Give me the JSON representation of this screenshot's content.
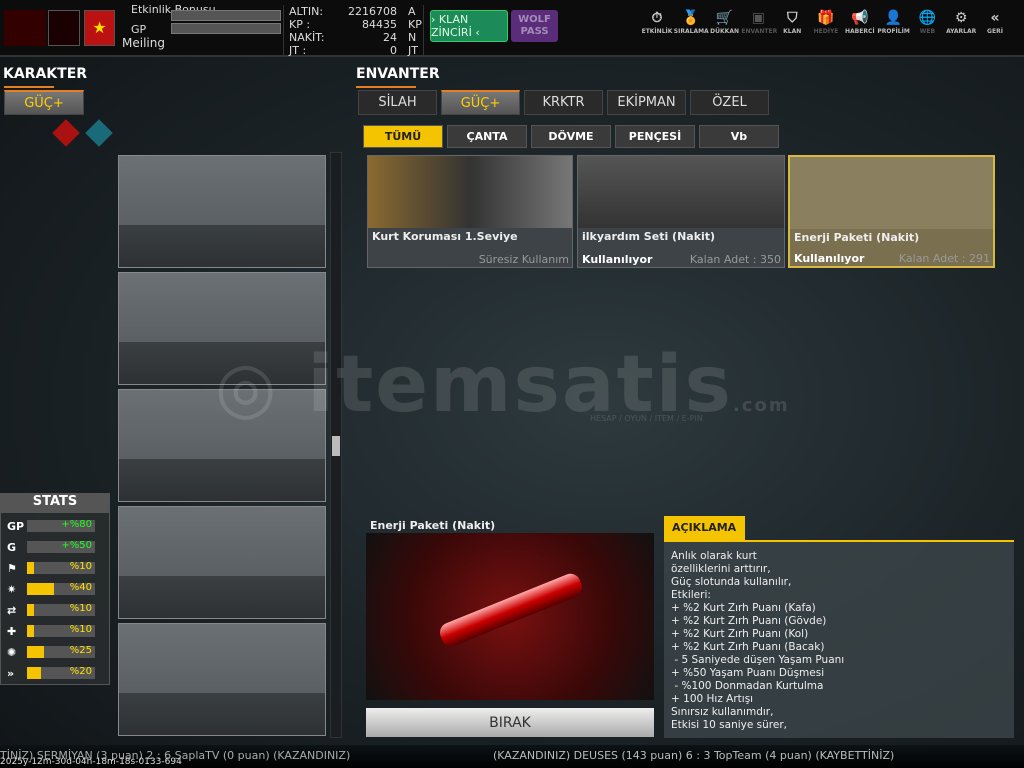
{
  "header": {
    "event_bonus_label": "Etkinlik Bonusu",
    "gp_label": "GP",
    "player_name": "Meiling",
    "currencies": [
      {
        "label": "ALTIN:",
        "value": "2216708",
        "unit": "A"
      },
      {
        "label": "KP :",
        "value": "84435",
        "unit": "KP"
      },
      {
        "label": "NAKİT:",
        "value": "24",
        "unit": "N"
      },
      {
        "label": "JT :",
        "value": "0",
        "unit": "JT"
      }
    ],
    "klan_button": "› KLAN ZİNCİRİ ‹",
    "wolf_pass": "WOLF PASS",
    "nav": [
      {
        "label": "ETKİNLİK",
        "icon": "⏱"
      },
      {
        "label": "SIRALAMA",
        "icon": "🏅"
      },
      {
        "label": "DÜKKAN",
        "icon": "🛒"
      },
      {
        "label": "ENVANTER",
        "icon": "▣"
      },
      {
        "label": "KLAN",
        "icon": "⛉"
      },
      {
        "label": "HEDİYE",
        "icon": "🎁"
      },
      {
        "label": "HABERCİ",
        "icon": "📢"
      },
      {
        "label": "PROFİLİM",
        "icon": "👤"
      },
      {
        "label": "WEB",
        "icon": "🌐"
      },
      {
        "label": "AYARLAR",
        "icon": "⚙"
      },
      {
        "label": "GERİ",
        "icon": "«"
      }
    ]
  },
  "left": {
    "title": "KARAKTER",
    "tab": "GÜÇ+"
  },
  "stats": {
    "title": "STATS",
    "rows": [
      {
        "icon": "GP",
        "value": "+%80",
        "color": "#22ff22",
        "fill": 0
      },
      {
        "icon": "G",
        "value": "+%50",
        "color": "#22ff22",
        "fill": 0
      },
      {
        "icon": "⚑",
        "value": "%10",
        "color": "#ffe000",
        "fill": 0.1
      },
      {
        "icon": "✷",
        "value": "%40",
        "color": "#ffe000",
        "fill": 0.4
      },
      {
        "icon": "⇄",
        "value": "%10",
        "color": "#ffe000",
        "fill": 0.1
      },
      {
        "icon": "✚",
        "value": "%10",
        "color": "#ffe000",
        "fill": 0.1
      },
      {
        "icon": "✺",
        "value": "%25",
        "color": "#ffe000",
        "fill": 0.25
      },
      {
        "icon": "»",
        "value": "%20",
        "color": "#ffe000",
        "fill": 0.2
      }
    ]
  },
  "inventory": {
    "title": "ENVANTER",
    "tabs": [
      "SİLAH",
      "GÜÇ+",
      "KRKTR",
      "EKİPMAN",
      "ÖZEL"
    ],
    "subtabs": [
      "TÜMÜ",
      "ÇANTA",
      "DÖVME",
      "PENÇESİ",
      "Vb"
    ],
    "items": [
      {
        "name": "Kurt Koruması 1.Seviye",
        "status": "",
        "qty": "Süresiz Kullanım"
      },
      {
        "name": "ilkyardım Seti (Nakit)",
        "status": "Kullanılıyor",
        "qty": "Kalan Adet : 350"
      },
      {
        "name": "Enerji Paketi (Nakit)",
        "status": "Kullanılıyor",
        "qty": "Kalan Adet : 291"
      }
    ]
  },
  "detail": {
    "title": "Enerji Paketi (Nakit)",
    "drop_button": "BIRAK",
    "desc_tab": "AÇIKLAMA",
    "desc_lines": [
      "Anlık olarak kurt",
      "özelliklerini arttırır,",
      "Güç slotunda kullanılır,",
      "Etkileri:",
      "+ %2 Kurt Zırh Puanı (Kafa)",
      "+ %2 Kurt Zırh Puanı (Gövde)",
      "+ %2 Kurt Zırh Puanı (Kol)",
      "+ %2 Kurt Zırh Puanı (Bacak)",
      " - 5 Saniyede düşen Yaşam Puanı",
      "+ %50 Yaşam Puanı Düşmesi",
      " - %100 Donmadan Kurtulma",
      "+ 100 Hız Artışı",
      "Sınırsız kullanımdır,",
      "Etkisi 10 saniye sürer,"
    ]
  },
  "watermark": {
    "brand": "itemsatis",
    "tagline": "HESAP / OYUN / ITEM / E-PIN",
    "suffix": ".com"
  },
  "ticker": {
    "left": "TİNİZ) SERMİYAN (3 puan) 2 : 6 SaplaTV (0 puan) (KAZANDINIZ)",
    "timestamp": "2025y-12m-30d-04h-18m-18s-0133-694",
    "right": "(KAZANDINIZ) DEUSES (143 puan) 6 : 3 TopTeam (4 puan) (KAYBETTİNİZ)"
  }
}
